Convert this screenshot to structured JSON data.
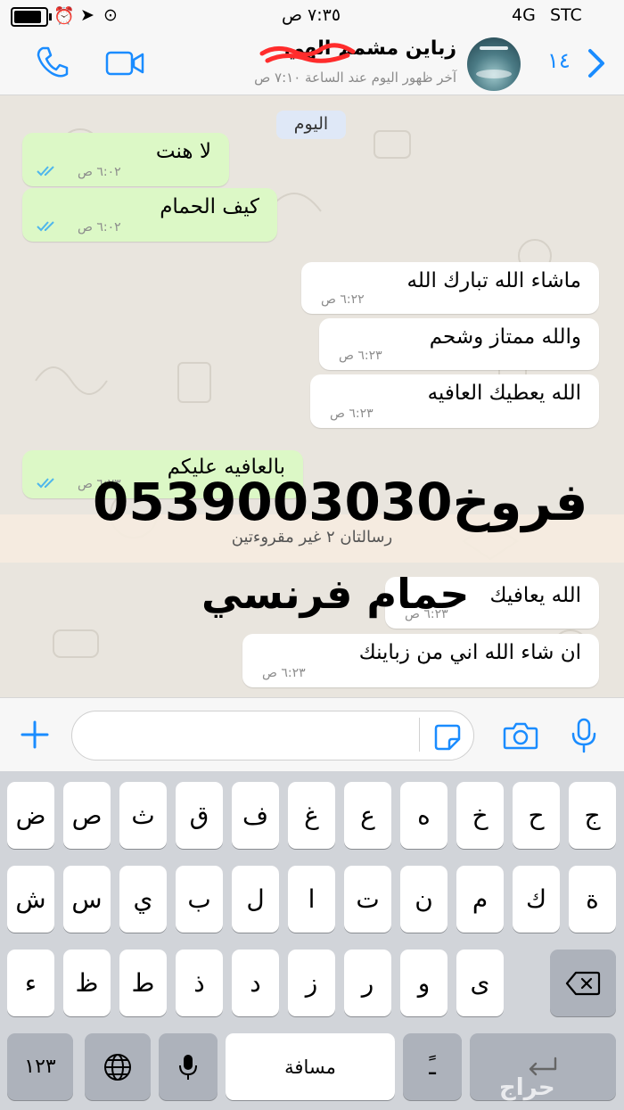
{
  "status_bar": {
    "carrier": "STC",
    "network": "4G",
    "time": "٧:٣٥ ص"
  },
  "header": {
    "back_count": "١٤",
    "contact_name": "زباين مشمم الهي",
    "last_seen": "آخر ظهور اليوم عند الساعة ٧:١٠ ص",
    "icons": [
      "chevron-left-icon",
      "video-call-icon",
      "phone-call-icon"
    ]
  },
  "chat": {
    "day_label": "اليوم",
    "messages": [
      {
        "direction": "out",
        "text": "لا هنت",
        "time": "٦:٠٢ ص",
        "status": "read"
      },
      {
        "direction": "out",
        "text": "كيف الحمام",
        "time": "٦:٠٢ ص",
        "status": "read"
      },
      {
        "direction": "in",
        "text": "ماشاء الله تبارك الله",
        "time": "٦:٢٢ ص"
      },
      {
        "direction": "in",
        "text": "والله ممتاز وشحم",
        "time": "٦:٢٣ ص"
      },
      {
        "direction": "in",
        "text": "الله يعطيك العافيه",
        "time": "٦:٢٣ ص"
      },
      {
        "direction": "out",
        "text": "بالعافيه عليكم",
        "time": "٦:٢٣ ص",
        "status": "read"
      },
      {
        "direction": "in",
        "text": "الله يعافيك",
        "time": "٦:٢٣ ص"
      },
      {
        "direction": "in",
        "text": "ان شاء الله اني من زباينك",
        "time": "٦:٢٣ ص"
      }
    ],
    "unread_banner": "رسالتان ٢ غير مقروءتين",
    "overlay_phone": "0539003030فروخ",
    "overlay_caption": "حمام فرنسي"
  },
  "composer": {
    "placeholder": "",
    "icons": [
      "plus-icon",
      "sticker-icon",
      "camera-icon",
      "microphone-icon"
    ]
  },
  "keyboard": {
    "row1": [
      "ض",
      "ص",
      "ث",
      "ق",
      "ف",
      "غ",
      "ع",
      "ه",
      "خ",
      "ح",
      "ج"
    ],
    "row2": [
      "ش",
      "س",
      "ي",
      "ب",
      "ل",
      "ا",
      "ت",
      "ن",
      "م",
      "ك",
      "ة"
    ],
    "row3": [
      "ء",
      "ظ",
      "ط",
      "ذ",
      "د",
      "ز",
      "ر",
      "و",
      "ى"
    ],
    "numbers_label": "١٢٣",
    "space_label": "مسافة",
    "watermark": "حراج",
    "colors": {
      "key": "#ffffff",
      "dark_key": "#adb2bb",
      "background": "#d1d4d9"
    }
  },
  "colors": {
    "accent_blue": "#1a8cff",
    "bubble_out": "#dcf8c6",
    "bubble_in": "#ffffff",
    "read_ticks": "#4fb6ec",
    "unread_banner_bg": "#f5ecdf"
  }
}
